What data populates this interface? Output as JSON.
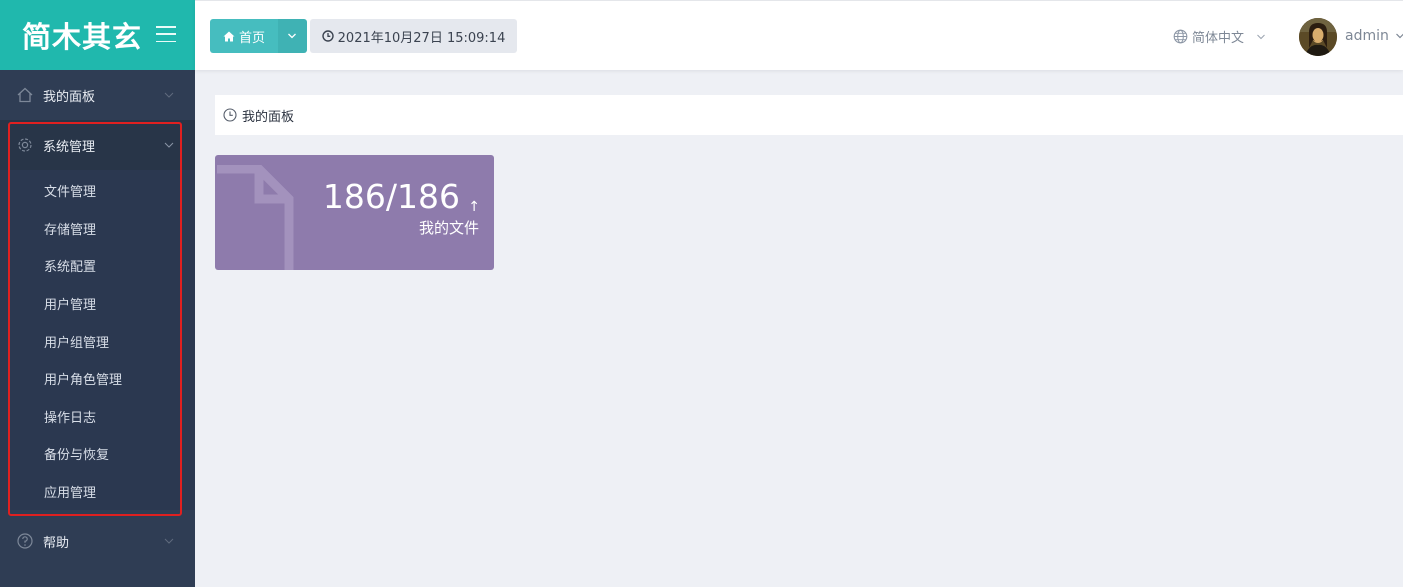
{
  "brand": {
    "title": "简木其玄"
  },
  "sidebar": {
    "dashboard_label": "我的面板",
    "system_label": "系统管理",
    "system_items": [
      "文件管理",
      "存储管理",
      "系统配置",
      "用户管理",
      "用户组管理",
      "用户角色管理",
      "操作日志",
      "备份与恢复",
      "应用管理"
    ],
    "help_label": "帮助"
  },
  "header": {
    "home_label": "首页",
    "datetime": "2021年10月27日 15:09:14",
    "language": "简体中文",
    "username": "admin"
  },
  "breadcrumb": {
    "label": "我的面板"
  },
  "card": {
    "count": "186/186",
    "label": "我的文件",
    "arrow": "↑"
  },
  "colors": {
    "brand": "#20b8ad",
    "sidebar": "#2f3d54",
    "card": "#8e7bac",
    "highlight": "#e02020"
  }
}
